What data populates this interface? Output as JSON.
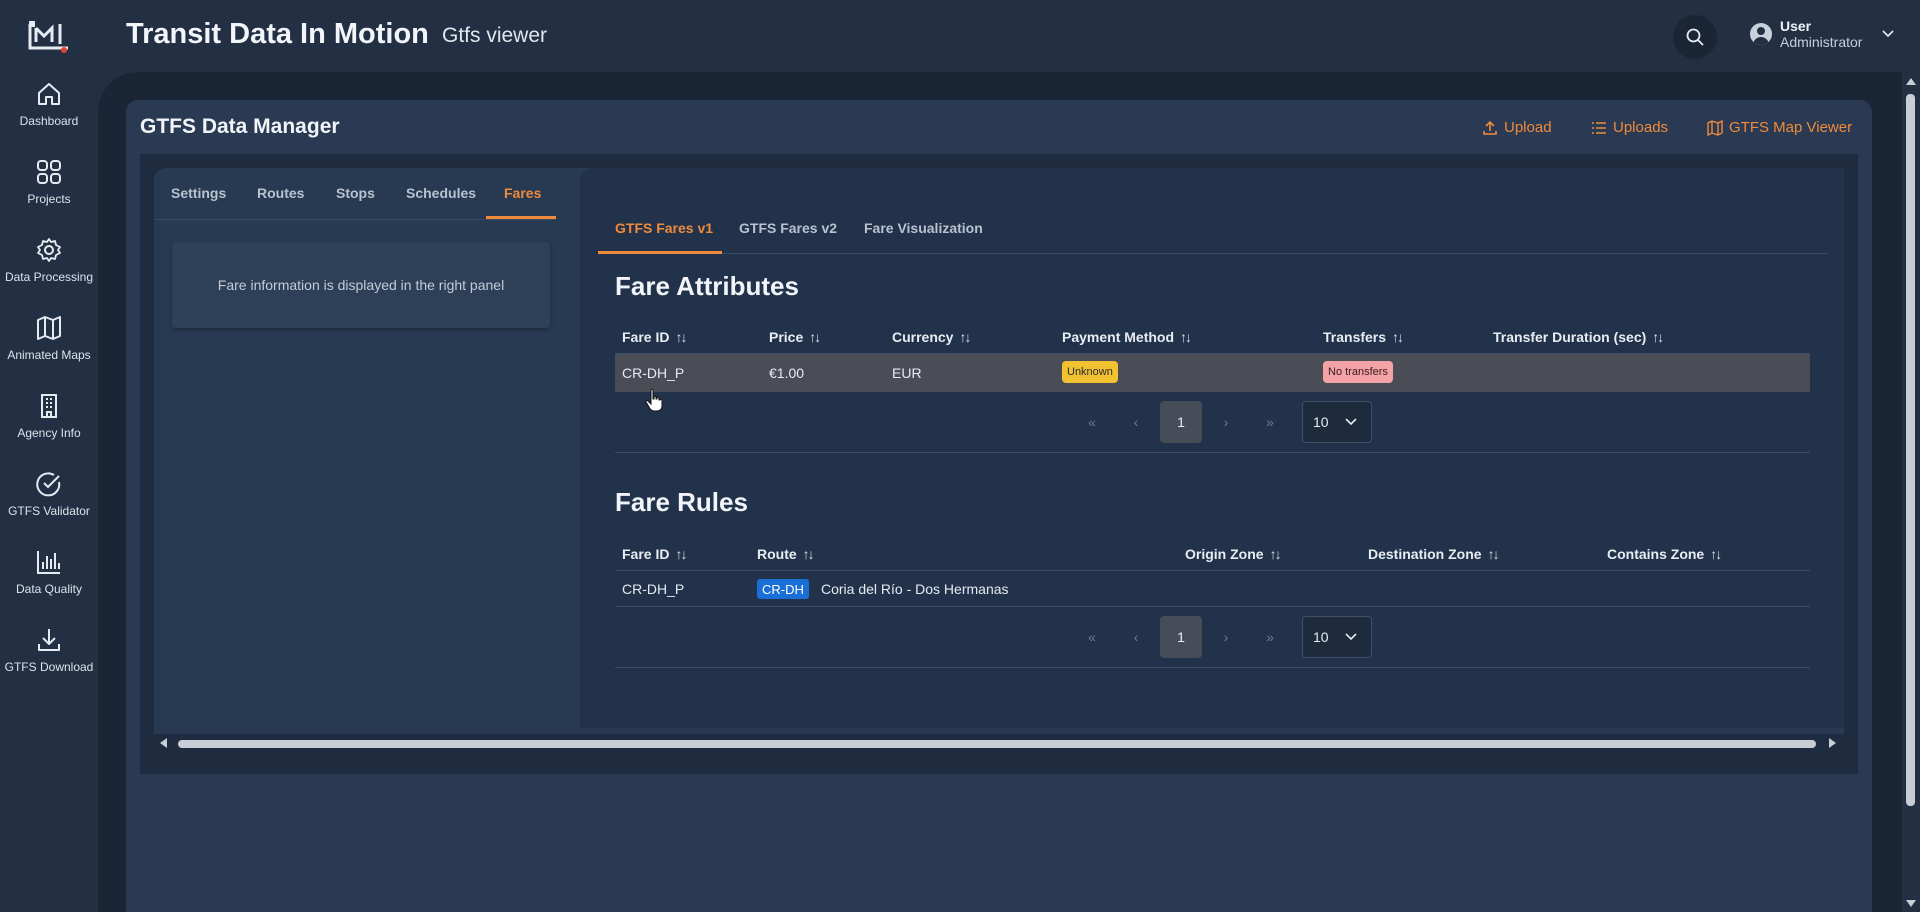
{
  "header": {
    "app_title": "Transit Data In Motion",
    "app_subtitle": "Gtfs viewer",
    "user_name": "User",
    "user_role": "Administrator"
  },
  "sidebar": {
    "items": [
      {
        "label": "Dashboard",
        "icon": "home-icon"
      },
      {
        "label": "Projects",
        "icon": "grid-icon"
      },
      {
        "label": "Data Processing",
        "icon": "gear-icon"
      },
      {
        "label": "Animated Maps",
        "icon": "map-icon"
      },
      {
        "label": "Agency Info",
        "icon": "building-icon"
      },
      {
        "label": "GTFS Validator",
        "icon": "check-circle-icon"
      },
      {
        "label": "Data Quality",
        "icon": "bar-chart-icon"
      },
      {
        "label": "GTFS Download",
        "icon": "download-icon"
      }
    ]
  },
  "card": {
    "title": "GTFS Data Manager",
    "upload": "Upload",
    "uploads": "Uploads",
    "map_viewer": "GTFS Map Viewer"
  },
  "left_tabs": [
    "Settings",
    "Routes",
    "Stops",
    "Schedules",
    "Fares"
  ],
  "left_info": "Fare information is displayed in the right panel",
  "right_tabs": [
    "GTFS Fares v1",
    "GTFS Fares v2",
    "Fare Visualization"
  ],
  "fare_attributes": {
    "title": "Fare Attributes",
    "headers": [
      "Fare ID",
      "Price",
      "Currency",
      "Payment Method",
      "Transfers",
      "Transfer Duration (sec)"
    ],
    "row": {
      "fare_id": "CR-DH_P",
      "price": "€1.00",
      "currency": "EUR",
      "payment": "Unknown",
      "transfers": "No transfers"
    },
    "page": "1",
    "per_page": "10"
  },
  "fare_rules": {
    "title": "Fare Rules",
    "headers": [
      "Fare ID",
      "Route",
      "Origin Zone",
      "Destination Zone",
      "Contains Zone"
    ],
    "row": {
      "fare_id": "CR-DH_P",
      "route_code": "CR-DH",
      "route_name": "Coria del Río - Dos Hermanas"
    },
    "page": "1",
    "per_page": "10"
  },
  "colors": {
    "accent": "#f08a3c",
    "background": "#233044",
    "badge_unknown": "#f2c232",
    "badge_no_transfers": "#f3a3a6",
    "route_badge": "#1a6fd6"
  }
}
